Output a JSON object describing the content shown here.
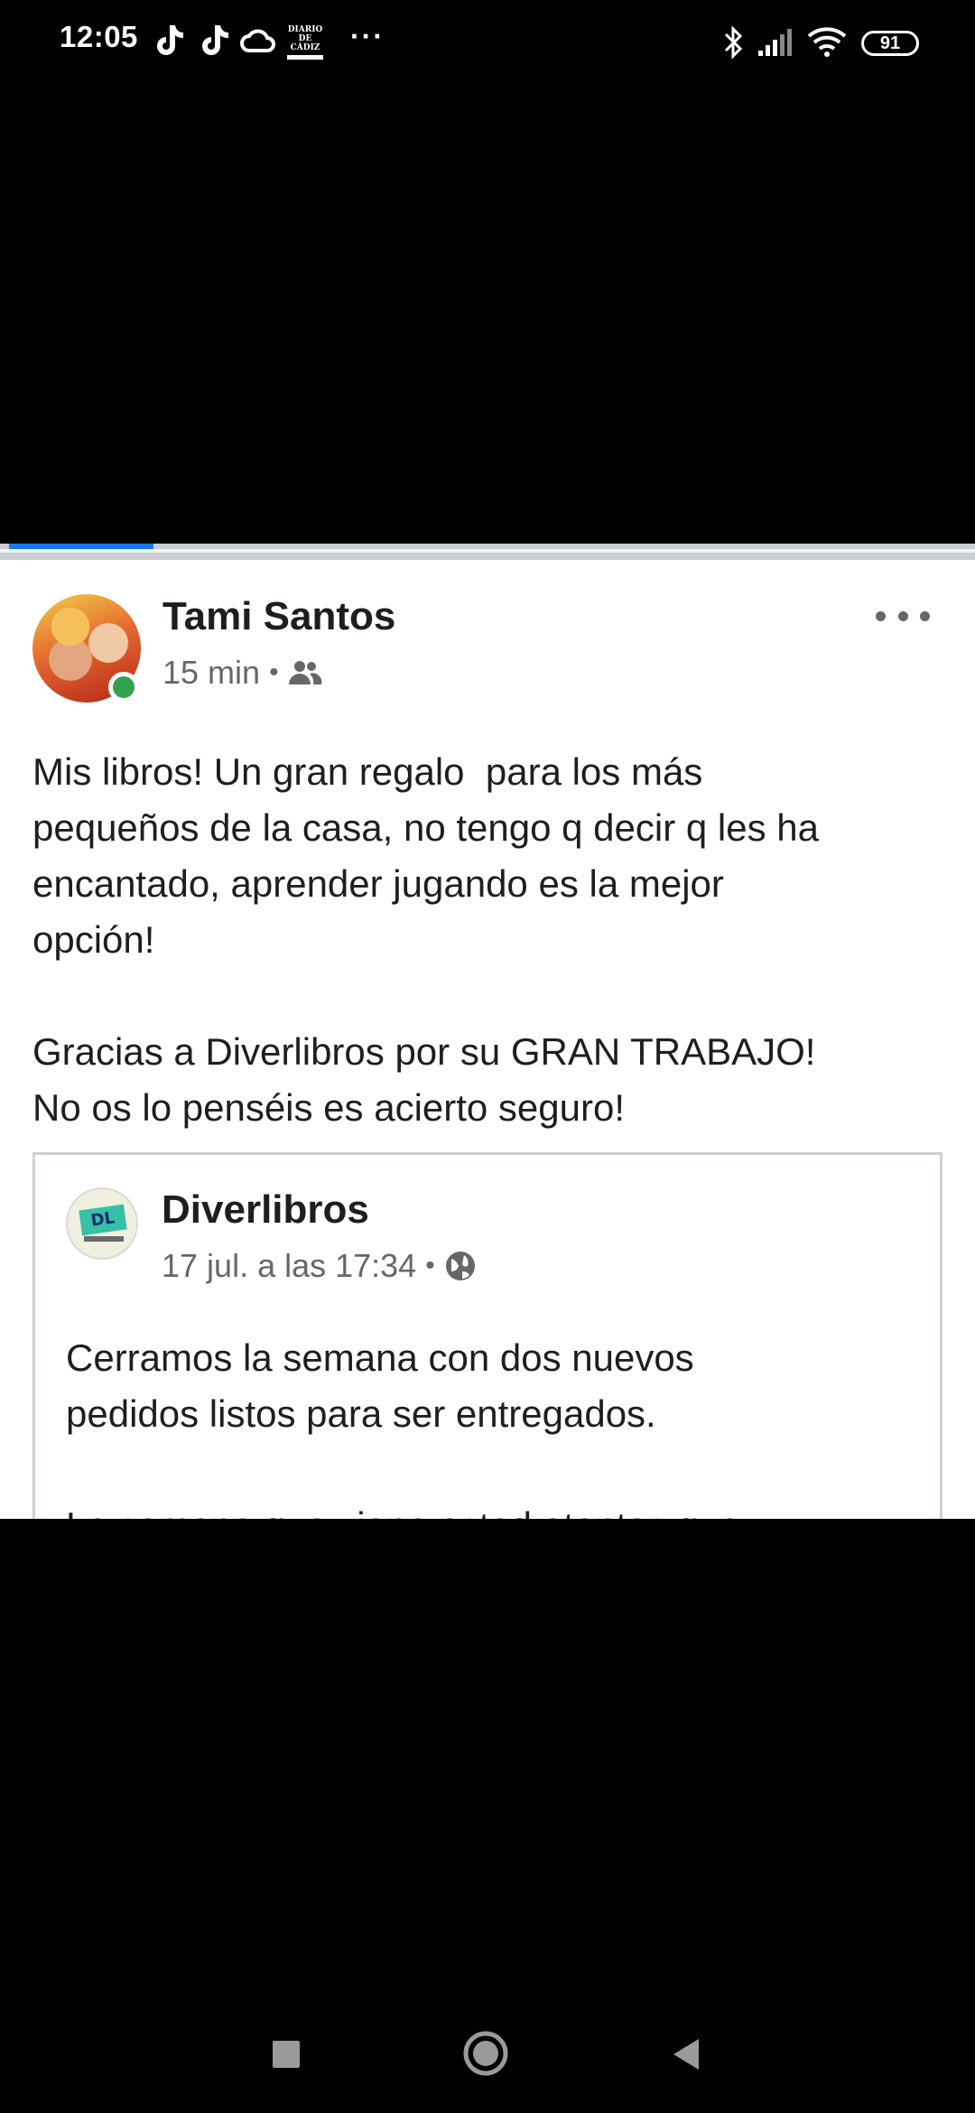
{
  "status_bar": {
    "time": "12:05",
    "news_label": "DIARIO DE CÁDIZ",
    "more": "···",
    "battery": "91"
  },
  "post": {
    "author": "Tami Santos",
    "time": "15 min",
    "separator": "•",
    "audience_icon": "friends-icon",
    "text": "Mis libros! Un gran regalo  para los más\npequeños de la casa, no tengo q decir q les ha\nencantado, aprender jugando es la mejor\nopción!\n\nGracias a Diverlibros por su GRAN TRABAJO!\nNo os lo penséis es acierto seguro!",
    "shared": {
      "page_name": "Diverlibros",
      "logo_text": "DL",
      "date": "17 jul. a las 17:34",
      "separator": "•",
      "audience_icon": "globe-icon",
      "text": "Cerramos la semana con dos nuevos\npedidos listos para ser entregados.\n\nLa semana que viene estad atentos que"
    }
  },
  "nav": {
    "recents": "square-icon",
    "home": "circle-icon",
    "back": "triangle-back-icon"
  }
}
